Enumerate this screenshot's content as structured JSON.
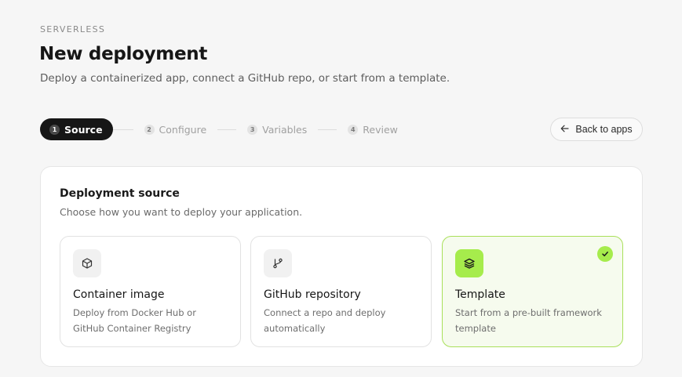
{
  "header": {
    "eyebrow": "SERVERLESS",
    "title": "New deployment",
    "subtitle": "Deploy a containerized app, connect a GitHub repo, or start from a template."
  },
  "stepper": {
    "steps": [
      {
        "num": "1",
        "label": "Source",
        "active": true
      },
      {
        "num": "2",
        "label": "Configure",
        "active": false
      },
      {
        "num": "3",
        "label": "Variables",
        "active": false
      },
      {
        "num": "4",
        "label": "Review",
        "active": false
      }
    ]
  },
  "back_button": {
    "label": "Back to apps",
    "icon": "arrow-left-icon"
  },
  "panel": {
    "title": "Deployment source",
    "subtitle": "Choose how you want to deploy your application.",
    "options": [
      {
        "icon": "cube-icon",
        "title": "Container image",
        "description": "Deploy from Docker Hub or GitHub Container Registry",
        "selected": false
      },
      {
        "icon": "git-branch-icon",
        "title": "GitHub repository",
        "description": "Connect a repo and deploy automatically",
        "selected": false
      },
      {
        "icon": "layers-icon",
        "title": "Template",
        "description": "Start from a pre-built framework template",
        "selected": true
      }
    ]
  },
  "colors": {
    "accent": "#a6ec4c",
    "selected_border": "#a9e05a",
    "selected_bg": "#f6fbee",
    "active_step_bg": "#161616"
  }
}
